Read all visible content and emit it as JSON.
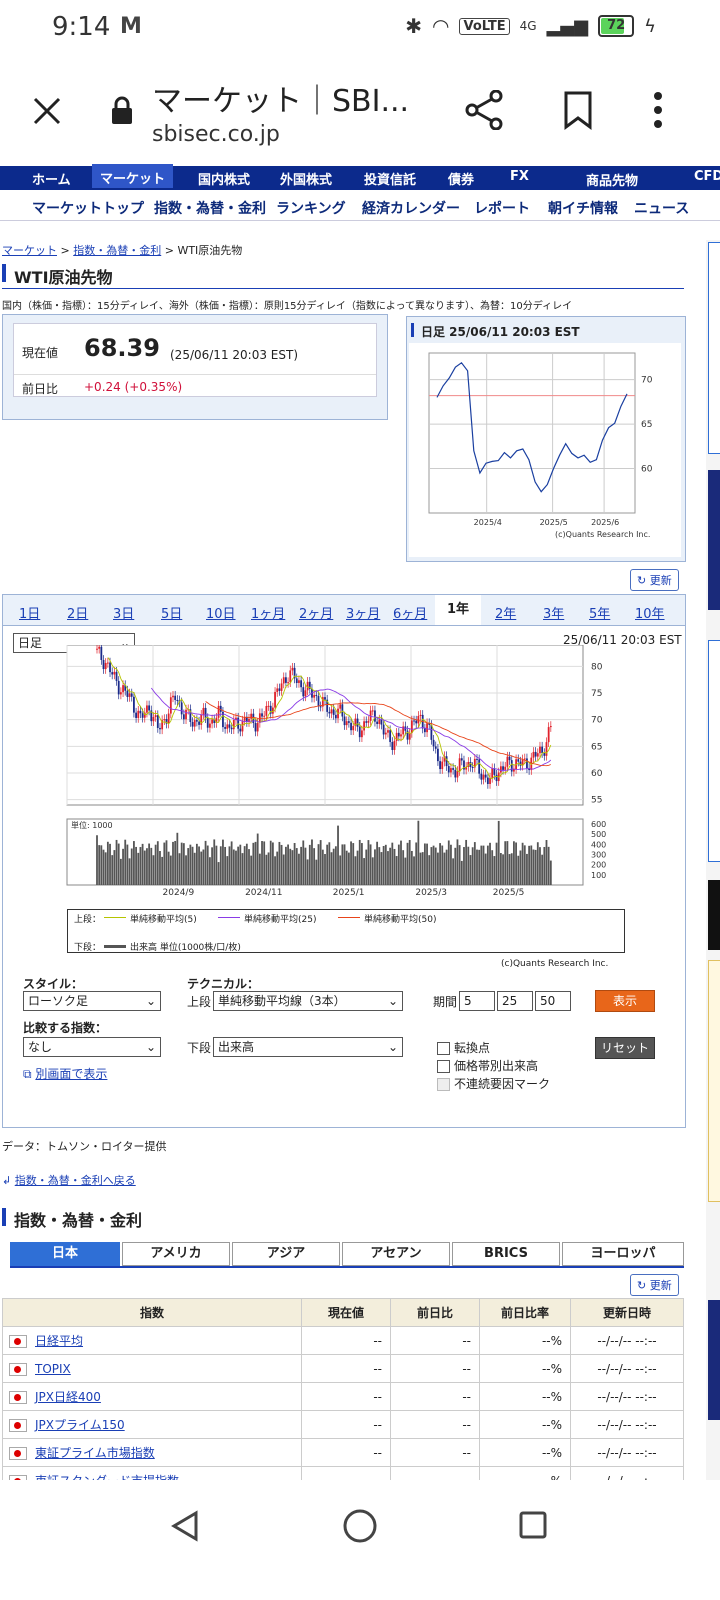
{
  "status": {
    "time": "9:14",
    "volte": "VoLTE",
    "net": "4G",
    "battery": "72"
  },
  "browser": {
    "title": "マーケット｜SBI...",
    "url": "sbisec.co.jp"
  },
  "nav_main": [
    "ホーム",
    "マーケット",
    "国内株式",
    "外国株式",
    "投資信託",
    "債券",
    "FX",
    "商品先物",
    "CFD"
  ],
  "nav_sub": [
    "マーケットトップ",
    "指数・為替・金利",
    "ランキング",
    "経済カレンダー",
    "レポート",
    "朝イチ情報",
    "ニュース"
  ],
  "breadcrumb": {
    "l1": "マーケット",
    "l2": "指数・為替・金利",
    "current": "WTI原油先物"
  },
  "page_title": "WTI原油先物",
  "delay_note": "国内（株価・指標）：15分ディレイ、海外（株価・指標）：原則15分ディレイ（指数によって異なります）、為替：10分ディレイ",
  "quote": {
    "price_label": "現在値",
    "price": "68.39",
    "time": "(25/06/11 20:03 EST)",
    "change_label": "前日比",
    "change": "+0.24",
    "change_pct": "(+0.35%)"
  },
  "mini_chart": {
    "header": "日足 25/06/11 20:03 EST",
    "credit": "(c)Quants Research Inc."
  },
  "update_label": "更新",
  "period_tabs": [
    "1日",
    "2日",
    "3日",
    "5日",
    "10日",
    "1ヶ月",
    "2ヶ月",
    "3ヶ月",
    "6ヶ月",
    "1年",
    "2年",
    "3年",
    "5年",
    "10年"
  ],
  "active_period": "1年",
  "chart_controls": {
    "interval": "日足",
    "timestamp": "25/06/11 20:03 EST"
  },
  "legend": {
    "upper_label": "上段：",
    "ma5": "単純移動平均(5)",
    "ma25": "単純移動平均(25)",
    "ma50": "単純移動平均(50)",
    "lower_label": "下段：",
    "volume": "出来高 単位(1000株/口/枚)"
  },
  "volume_unit": "単位: 1000",
  "credit": "(c)Quants Research Inc.",
  "controls": {
    "style_label": "スタイル：",
    "style_value": "ローソク足",
    "tech_label": "テクニカル：",
    "upper": "上段",
    "upper_value": "単純移動平均線（3本）",
    "period_label": "期間",
    "p1": "5",
    "p2": "25",
    "p3": "50",
    "show_btn": "表示",
    "compare_label": "比較する指数：",
    "compare_value": "なし",
    "lower": "下段",
    "lower_value": "出来高",
    "cb1": "転換点",
    "cb2": "価格帯別出来高",
    "cb3": "不連続要因マーク",
    "reset_btn": "リセット",
    "open_link": "別画面で表示"
  },
  "data_source": "データ：トムソン・ロイター提供",
  "back_link": "指数・為替・金利へ戻る",
  "section2_title": "指数・為替・金利",
  "region_tabs": [
    "日本",
    "アメリカ",
    "アジア",
    "アセアン",
    "BRICS",
    "ヨーロッパ"
  ],
  "table": {
    "headers": [
      "指数",
      "現在値",
      "前日比",
      "前日比率",
      "更新日時"
    ],
    "rows": [
      {
        "name": "日経平均",
        "price": "--",
        "chg": "--",
        "pct": "--%",
        "time": "--/--/-- --:--"
      },
      {
        "name": "TOPIX",
        "price": "--",
        "chg": "--",
        "pct": "--%",
        "time": "--/--/-- --:--"
      },
      {
        "name": "JPX日経400",
        "price": "--",
        "chg": "--",
        "pct": "--%",
        "time": "--/--/-- --:--"
      },
      {
        "name": "JPXプライム150",
        "price": "--",
        "chg": "--",
        "pct": "--%",
        "time": "--/--/-- --:--"
      },
      {
        "name": "東証プライム市場指数",
        "price": "--",
        "chg": "--",
        "pct": "--%",
        "time": "--/--/-- --:--"
      },
      {
        "name": "東証スタンダード市場指数",
        "price": "--",
        "chg": "--",
        "pct": "--%",
        "time": "--/--/-- --:--"
      }
    ]
  },
  "chart_data": [
    {
      "type": "line",
      "title": "日足 25/06/11 20:03 EST",
      "x_ticks": [
        "2025/4",
        "2025/5",
        "2025/6"
      ],
      "y_ticks": [
        60,
        65,
        70
      ],
      "ylim": [
        55,
        73
      ],
      "reference_line": 68.2,
      "series": [
        {
          "values": [
            68.0,
            69.3,
            70.2,
            71.4,
            71.9,
            71.0,
            62.0,
            59.5,
            60.6,
            60.8,
            60.9,
            61.8,
            61.2,
            62.0,
            62.2,
            61.0,
            58.5,
            57.4,
            58.2,
            60.0,
            61.5,
            62.8,
            61.7,
            61.2,
            61.5,
            60.7,
            61.0,
            63.2,
            64.6,
            65.1,
            67.0,
            68.4
          ]
        }
      ]
    },
    {
      "type": "candlestick",
      "x_ticks": [
        "2024/9",
        "2024/11",
        "2025/1",
        "2025/3",
        "2025/5"
      ],
      "y_ticks": [
        55,
        60,
        65,
        70,
        75,
        80
      ],
      "ylim": [
        54,
        84
      ],
      "price_path": [
        82.5,
        80.8,
        77.5,
        75.5,
        73.5,
        70.0,
        72.5,
        68.0,
        71.0,
        74.5,
        71.0,
        69.5,
        70.5,
        69.5,
        71.0,
        68.5,
        69.0,
        70.0,
        69.5,
        70.5,
        73.0,
        76.0,
        79.0,
        77.0,
        75.5,
        74.5,
        72.5,
        71.5,
        71.0,
        69.0,
        68.0,
        70.0,
        71.0,
        67.0,
        66.0,
        67.5,
        68.5,
        70.5,
        68.0,
        63.0,
        61.0,
        60.5,
        61.5,
        62.0,
        60.0,
        58.5,
        60.5,
        61.5,
        62.0,
        61.5,
        63.0,
        64.0,
        68.4
      ],
      "ma_labels": [
        "単純移動平均(5)",
        "単純移動平均(25)",
        "単純移動平均(50)"
      ],
      "volume_ticks": [
        100,
        200,
        300,
        400,
        500,
        600
      ],
      "volume_unit": "単位: 1000"
    }
  ]
}
